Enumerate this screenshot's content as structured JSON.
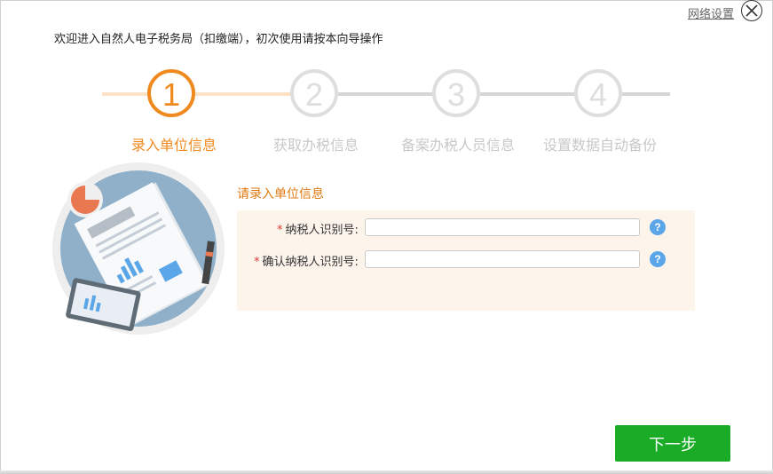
{
  "header": {
    "network_settings": "网络设置",
    "welcome": "欢迎进入自然人电子税务局（扣缴端），初次使用请按本向导操作"
  },
  "steps": [
    {
      "number": "1",
      "label": "录入单位信息",
      "state": "active"
    },
    {
      "number": "2",
      "label": "获取办税信息",
      "state": "idle"
    },
    {
      "number": "3",
      "label": "备案办税人员信息",
      "state": "idle"
    },
    {
      "number": "4",
      "label": "设置数据自动备份",
      "state": "idle"
    }
  ],
  "form": {
    "title": "请录入单位信息",
    "fields": [
      {
        "label": "纳税人识别号:",
        "value": "",
        "required": true
      },
      {
        "label": "确认纳税人识别号:",
        "value": "",
        "required": true
      }
    ],
    "help_glyph": "?"
  },
  "actions": {
    "next": "下一步"
  },
  "colors": {
    "accent": "#f08a1e",
    "inactive": "#dedede",
    "panel_bg": "#fdf4ec",
    "button_green": "#1aab27",
    "help_blue": "#5aa6e8"
  },
  "icons": [
    "close-icon",
    "help-icon",
    "document-illustration"
  ]
}
